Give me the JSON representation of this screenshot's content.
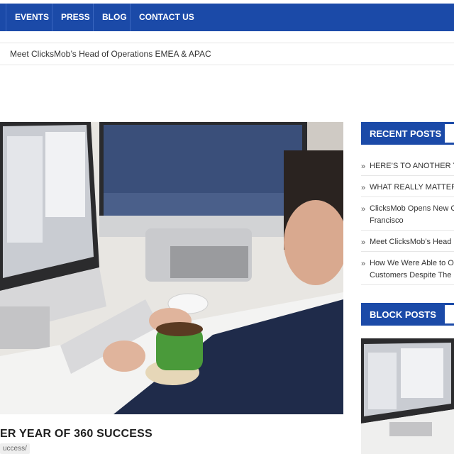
{
  "nav": {
    "items": [
      "EVENTS",
      "PRESS",
      "BLOG",
      "CONTACT US"
    ]
  },
  "ticker": {
    "text": "Meet ClicksMob’s Head of Operations EMEA & APAC"
  },
  "post": {
    "title": "ER YEAR OF 360 SUCCESS",
    "url_fragment": "uccess/"
  },
  "sidebar": {
    "recent_posts_title": "RECENT POSTS",
    "recent_posts": [
      [
        "HERE’S TO ANOTHER Y"
      ],
      [
        "WHAT REALLY MATTER"
      ],
      [
        "ClicksMob Opens New C",
        "Francisco"
      ],
      [
        "Meet ClicksMob’s Head"
      ],
      [
        "How We Were Able to O",
        "Customers Despite The"
      ]
    ],
    "block_posts_title": "BLOCK POSTS"
  },
  "colors": {
    "brand_blue": "#1b4aa8",
    "text_dark": "#1e1e1e"
  }
}
